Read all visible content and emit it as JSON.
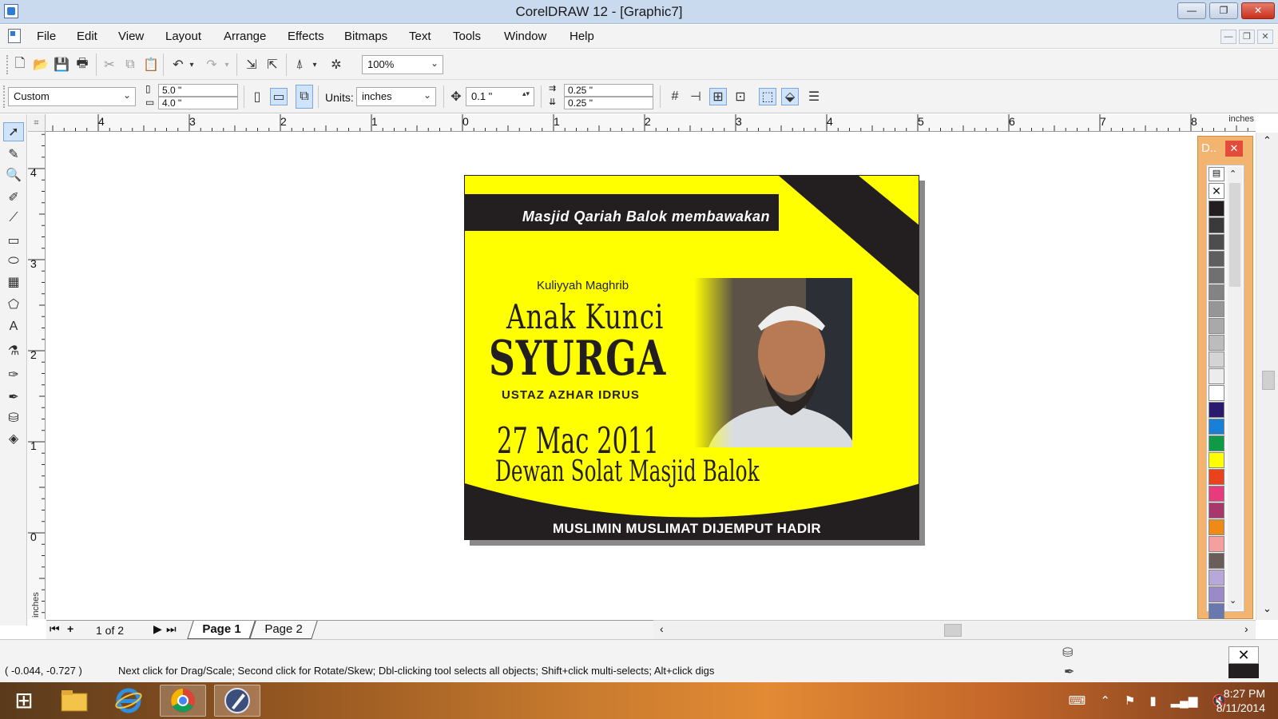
{
  "window": {
    "title": "CorelDRAW 12 - [Graphic7]",
    "min_label": "—",
    "max_label": "❐",
    "close_label": "✕"
  },
  "menu": {
    "items": [
      "File",
      "Edit",
      "View",
      "Layout",
      "Arrange",
      "Effects",
      "Bitmaps",
      "Text",
      "Tools",
      "Window",
      "Help"
    ]
  },
  "toolbar": {
    "zoom": "100%"
  },
  "property_bar": {
    "paper_type": "Custom",
    "width": "5.0 \"",
    "height": "4.0 \"",
    "units_label": "Units:",
    "units_value": "inches",
    "nudge": "0.1 \"",
    "dup_x": "0.25 \"",
    "dup_y": "0.25 \""
  },
  "ruler": {
    "units": "inches",
    "h_labels": [
      "4",
      "3",
      "2",
      "1",
      "0",
      "1",
      "2",
      "3",
      "4",
      "5",
      "6",
      "7",
      "8"
    ],
    "v_labels": [
      "4",
      "3",
      "2",
      "1",
      "0"
    ]
  },
  "flyer": {
    "header_text": "Masjid Qariah Balok membawakan",
    "subtitle": "Kuliyyah Maghrib",
    "title_line1": "Anak Kunci",
    "title_line2": "SYURGA",
    "speaker": "USTAZ AZHAR IDRUS",
    "date": "27 Mac 2011",
    "venue": "Dewan Solat Masjid Balok",
    "footer_text": "MUSLIMIN MUSLIMAT DIJEMPUT HADIR",
    "colors": {
      "background": "#ffff00",
      "dark": "#231f20"
    }
  },
  "docker": {
    "title": "D..",
    "close_label": "✕",
    "swatches": [
      "#231f20",
      "#3a3a3a",
      "#4d4d4d",
      "#5e5e5e",
      "#707070",
      "#838383",
      "#969696",
      "#a9a9a9",
      "#bcbcbc",
      "#d4d4d4",
      "#ececec",
      "#ffffff",
      "#2a1b6e",
      "#1a7fd6",
      "#0f9a48",
      "#ffff00",
      "#e8431c",
      "#e83b7e",
      "#a8386b",
      "#f08a16",
      "#f5a0a0",
      "#6a5e5a",
      "#b8a8d8",
      "#9a8ac8",
      "#6a78b0"
    ]
  },
  "pages": {
    "counter": "1 of 2",
    "tabs": [
      "Page 1",
      "Page 2"
    ],
    "active": "Page 1"
  },
  "status": {
    "coords": "( -0.044, -0.727 )",
    "message": "Next click for Drag/Scale; Second click for Rotate/Skew; Dbl-clicking tool selects all objects; Shift+click multi-selects; Alt+click digs"
  },
  "taskbar": {
    "time": "8:27 PM",
    "date": "8/11/2014"
  }
}
